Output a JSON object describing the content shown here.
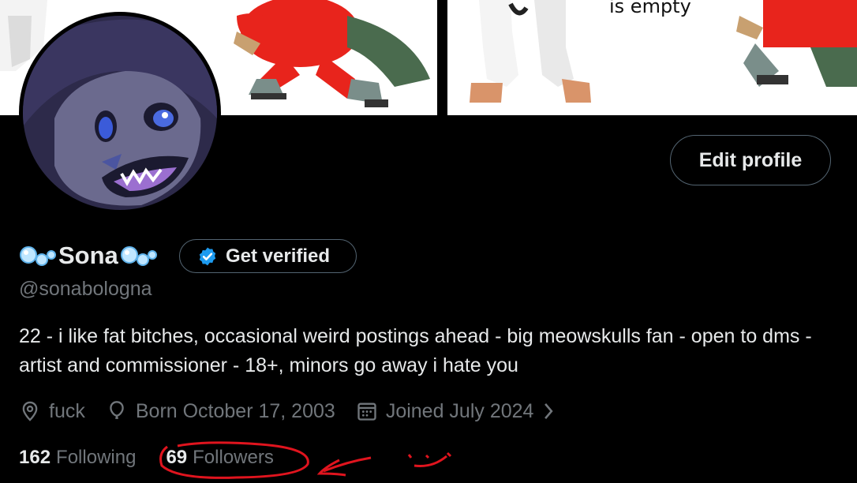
{
  "banner": {
    "caption": "is empty"
  },
  "profile": {
    "display_name": "Sona",
    "handle": "@sonabologna",
    "bio": "22 - i like fat bitches, occasional weird postings ahead - big meowskulls fan - open to dms - artist and commissioner - 18+, minors go away i hate you",
    "edit_label": "Edit profile",
    "verify_label": "Get verified"
  },
  "meta": {
    "location": "fuck",
    "birthday": "Born October 17, 2003",
    "joined": "Joined July 2024"
  },
  "stats": {
    "following_count": "162",
    "following_label": "Following",
    "followers_count": "69",
    "followers_label": "Followers"
  },
  "colors": {
    "background": "#000000",
    "text": "#e7e9ea",
    "muted": "#71767b",
    "border": "#536471",
    "verified_blue": "#1d9bf0",
    "annotation_red": "#e0141e"
  },
  "icons": [
    "location-pin-icon",
    "birthday-balloon-icon",
    "calendar-icon",
    "chevron-right-icon",
    "verified-badge-icon",
    "bubbles-emoji-icon"
  ]
}
